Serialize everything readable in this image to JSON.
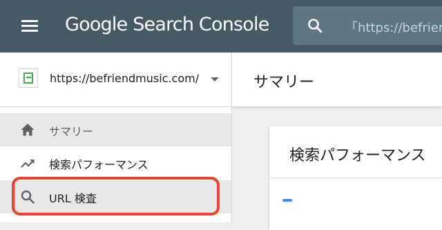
{
  "topbar": {
    "logo_text": "Google Search Console",
    "search_text": "「https://befriendmusic"
  },
  "property": {
    "url": "https://befriendmusic.com/"
  },
  "nav": {
    "items": [
      {
        "label": "サマリー",
        "icon": "home-icon",
        "active": true
      },
      {
        "label": "検索パフォーマンス",
        "icon": "trending-up-icon",
        "active": false
      },
      {
        "label": "URL 検査",
        "icon": "search-icon",
        "active": false
      }
    ]
  },
  "main": {
    "page_title": "サマリー",
    "card_title": "検索パフォーマンス"
  },
  "colors": {
    "topbar": "#455a64",
    "highlight": "#f4412f",
    "favicon_green": "#37b24d",
    "accent_blue": "#4285f4"
  }
}
